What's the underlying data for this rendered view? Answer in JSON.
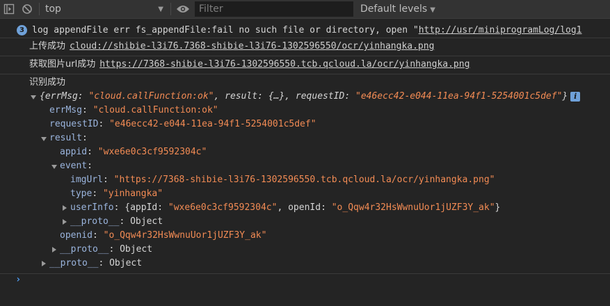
{
  "toolbar": {
    "context": "top",
    "filter_placeholder": "Filter",
    "levels": "Default levels"
  },
  "messages": [
    {
      "count": "3",
      "text": "log appendFile err fs_appendFile:fail no such file or directory, open \"",
      "link": "http://usr/miniprogramLog/log1"
    },
    {
      "label": "上传成功",
      "link": "cloud://shibie-l3i76.7368-shibie-l3i76-1302596550/ocr/yinhangka.png"
    },
    {
      "label": "获取图片url成功",
      "link": "https://7368-shibie-l3i76-1302596550.tcb.qcloud.la/ocr/yinhangka.png"
    }
  ],
  "result": {
    "label": "识别成功",
    "summary": {
      "open": "{",
      "errMsg_key": "errMsg",
      "errMsg_val": "\"cloud.callFunction:ok\"",
      "result_key": "result",
      "result_val": "{…}",
      "requestID_key": "requestID",
      "requestID_val": "\"e46ecc42-e044-11ea-94f1-5254001c5def\"",
      "close": "}"
    },
    "errMsg_key": "errMsg",
    "errMsg_val": "\"cloud.callFunction:ok\"",
    "requestID_key": "requestID",
    "requestID_val": "\"e46ecc42-e044-11ea-94f1-5254001c5def\"",
    "result_key": "result",
    "appid_key": "appid",
    "appid_val": "\"wxe6e0c3cf9592304c\"",
    "event_key": "event",
    "imgUrl_key": "imgUrl",
    "imgUrl_val": "\"https://7368-shibie-l3i76-1302596550.tcb.qcloud.la/ocr/yinhangka.png\"",
    "type_key": "type",
    "type_val": "\"yinhangka\"",
    "userInfo_key": "userInfo",
    "userInfo_appId_key": "appId",
    "userInfo_appId_val": "\"wxe6e0c3cf9592304c\"",
    "userInfo_openId_key": "openId",
    "userInfo_openId_val": "\"o_Qqw4r32HsWwnuUor1jUZF3Y_ak\"",
    "proto_key": "__proto__",
    "proto_val": "Object",
    "openid_key": "openid",
    "openid_val": "\"o_Qqw4r32HsWwnuUor1jUZF3Y_ak\""
  }
}
